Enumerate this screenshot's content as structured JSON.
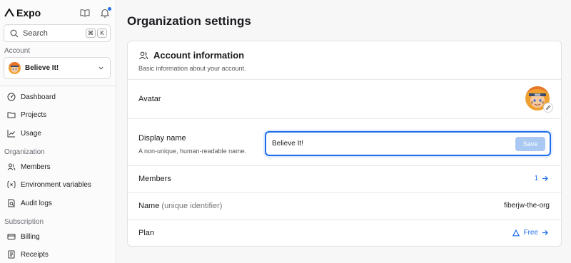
{
  "sidebar": {
    "brand": "Expo",
    "search": {
      "placeholder": "Search",
      "shortcut_keys": [
        "⌘",
        "K"
      ]
    },
    "account_label": "Account",
    "account_name": "Believe It!",
    "nav": [
      {
        "label": "Dashboard",
        "icon": "dashboard-icon"
      },
      {
        "label": "Projects",
        "icon": "folder-icon"
      },
      {
        "label": "Usage",
        "icon": "chart-line-icon"
      }
    ],
    "organization_label": "Organization",
    "organization_nav": [
      {
        "label": "Members",
        "icon": "users-icon"
      },
      {
        "label": "Environment variables",
        "icon": "variable-icon"
      },
      {
        "label": "Audit logs",
        "icon": "audit-log-icon"
      }
    ],
    "subscription_label": "Subscription",
    "subscription_nav": [
      {
        "label": "Billing",
        "icon": "credit-card-icon"
      },
      {
        "label": "Receipts",
        "icon": "receipt-icon"
      }
    ]
  },
  "main": {
    "page_title": "Organization settings",
    "card": {
      "title": "Account information",
      "subtitle": "Basic information about your account.",
      "avatar_label": "Avatar",
      "display_name_label": "Display name",
      "display_name_help": "A non-unique, human-readable name.",
      "display_name_value": "Believe It!",
      "save_label": "Save",
      "members_label": "Members",
      "members_count": "1",
      "name_label": "Name",
      "name_hint": "(unique identifier)",
      "name_value": "fiberjw-the-org",
      "plan_label": "Plan",
      "plan_value": "Free"
    }
  },
  "colors": {
    "accent": "#1f6feb",
    "save_disabled": "#a9c9f3"
  }
}
